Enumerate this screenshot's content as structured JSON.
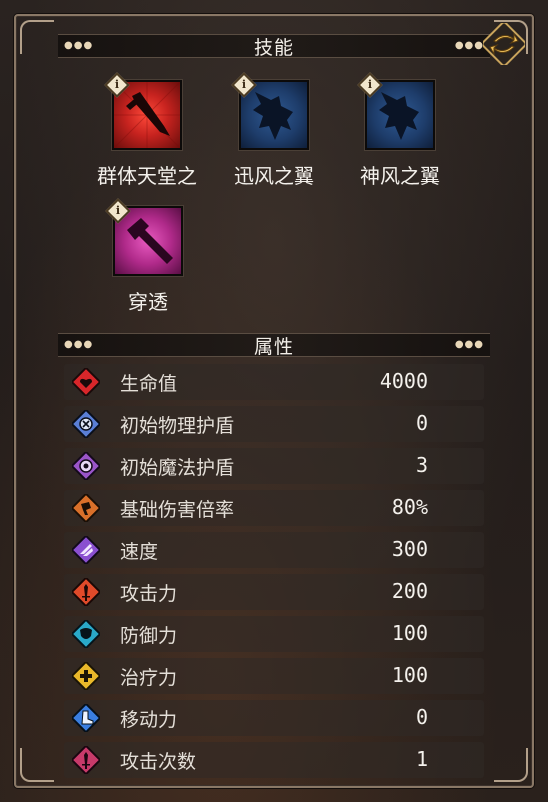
{
  "skills_header": {
    "title": "技能"
  },
  "skills": [
    {
      "label": "群体天堂之",
      "icon": "sword-icon",
      "color": "#c7231f"
    },
    {
      "label": "迅风之翼",
      "icon": "wing-icon",
      "color": "#1e3d6b"
    },
    {
      "label": "神风之翼",
      "icon": "wing-icon",
      "color": "#1e3d6b"
    },
    {
      "label": "穿透",
      "icon": "spear-icon",
      "color": "#b02a8a"
    }
  ],
  "info_badge": "i",
  "attributes_header": {
    "title": "属性"
  },
  "attributes": [
    {
      "name": "生命值",
      "value": "4000",
      "icon": "heart-icon",
      "color": "#d8262a"
    },
    {
      "name": "初始物理护盾",
      "value": "0",
      "icon": "physical-shield-icon",
      "color": "#5a7fd6"
    },
    {
      "name": "初始魔法护盾",
      "value": "3",
      "icon": "magic-shield-icon",
      "color": "#9a55c9"
    },
    {
      "name": "基础伤害倍率",
      "value": "80%",
      "icon": "damage-rate-icon",
      "color": "#d9702a"
    },
    {
      "name": "速度",
      "value": "300",
      "icon": "speed-wing-icon",
      "color": "#8a4fd0"
    },
    {
      "name": "攻击力",
      "value": "200",
      "icon": "attack-sword-icon",
      "color": "#e04a2a"
    },
    {
      "name": "防御力",
      "value": "100",
      "icon": "defense-icon",
      "color": "#2aa9c9"
    },
    {
      "name": "治疗力",
      "value": "100",
      "icon": "heal-cross-icon",
      "color": "#e9b82a"
    },
    {
      "name": "移动力",
      "value": "0",
      "icon": "boot-icon",
      "color": "#3a7ee0"
    },
    {
      "name": "攻击次数",
      "value": "1",
      "icon": "attack-count-icon",
      "color": "#c73a6a"
    }
  ]
}
